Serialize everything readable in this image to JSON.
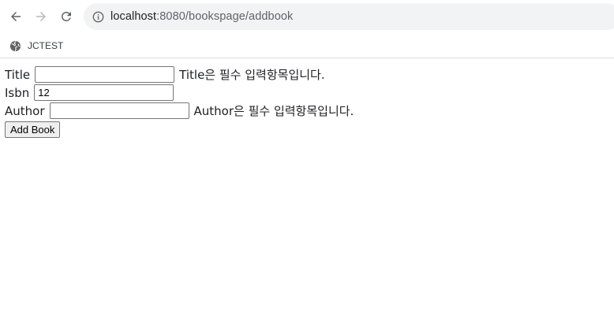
{
  "browser": {
    "url_host": "localhost",
    "url_rest": ":8080/bookspage/addbook",
    "bookmarks": [
      {
        "label": "JCTEST"
      }
    ],
    "icons": [
      "back-arrow-icon",
      "forward-arrow-icon",
      "reload-icon",
      "info-icon",
      "globe-icon"
    ]
  },
  "form": {
    "title": {
      "label": "Title",
      "value": "",
      "error": "Title은 필수 입력항목입니다."
    },
    "isbn": {
      "label": "Isbn",
      "value": "12"
    },
    "author": {
      "label": "Author",
      "value": "",
      "error": "Author은 필수 입력항목입니다."
    },
    "submit_label": "Add Book"
  }
}
